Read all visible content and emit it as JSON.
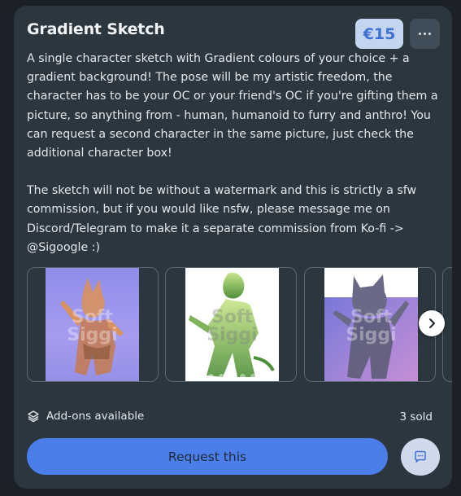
{
  "product": {
    "title": "Gradient Sketch",
    "price": "€15",
    "description_p1": "A single character sketch with Gradient colours of your choice + a gradient background! The pose will be my artistic freedom, the character has to be your OC or your friend's OC if you're gifting them a picture, so anything from - human, humanoid to furry and anthro! You can request a second character in the same picture, just check the additional character box!",
    "description_p2": "The sketch will not be without a watermark and this is strictly a sfw commission, but if you would like nsfw, please message me on Discord/Telegram to make it a separate commission from Ko-fi -> @Sigoogle :)"
  },
  "gallery": {
    "images": [
      {
        "name": "gallery-image-1",
        "watermark": [
          "Soft",
          "Siggi"
        ]
      },
      {
        "name": "gallery-image-2",
        "watermark": [
          "Soft",
          "Siggi"
        ]
      },
      {
        "name": "gallery-image-3",
        "watermark": [
          "Soft",
          "Siggi"
        ]
      }
    ],
    "pagination_count": 6,
    "active_index": 0
  },
  "footer": {
    "addons_label": "Add-ons available",
    "sold_label": "3 sold",
    "request_label": "Request this"
  },
  "icons": {
    "more": "more-options-icon",
    "next": "chevron-right-icon",
    "addons": "layers-icon",
    "chat": "chat-bubble-icon"
  },
  "colors": {
    "card_bg": "#2b363f",
    "accent": "#4b7ee8",
    "price_bg": "#c3d5ef",
    "price_text": "#3f6fd1"
  }
}
